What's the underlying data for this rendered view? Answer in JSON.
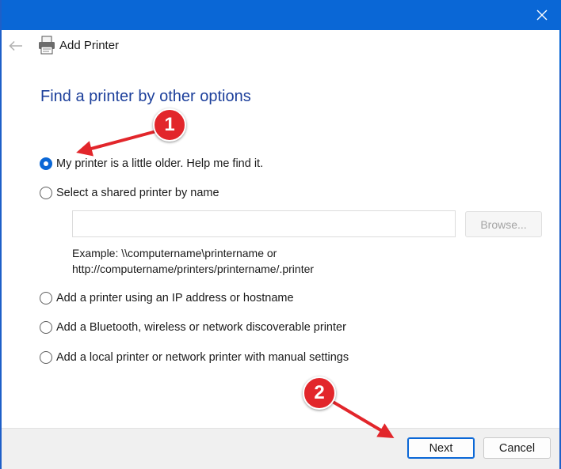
{
  "window": {
    "title": "Add Printer",
    "accent_color": "#0a67d6",
    "heading_color": "#1c3f9b",
    "icons": {
      "close": "close-icon",
      "back": "back-arrow-icon",
      "app": "printer-icon"
    }
  },
  "page": {
    "heading": "Find a printer by other options"
  },
  "options": [
    {
      "label": "My printer is a little older. Help me find it.",
      "checked": true
    },
    {
      "label": "Select a shared printer by name",
      "checked": false
    },
    {
      "label": "Add a printer using an IP address or hostname",
      "checked": false
    },
    {
      "label": "Add a Bluetooth, wireless or network discoverable printer",
      "checked": false
    },
    {
      "label": "Add a local printer or network printer with manual settings",
      "checked": false
    }
  ],
  "shared_printer": {
    "input_value": "",
    "browse_label": "Browse...",
    "example_line1": "Example: \\\\computername\\printername or",
    "example_line2": "http://computername/printers/printername/.printer"
  },
  "footer": {
    "next_label": "Next",
    "cancel_label": "Cancel"
  },
  "annotations": {
    "badge1": "1",
    "badge2": "2",
    "badge_color": "#e2262b"
  }
}
